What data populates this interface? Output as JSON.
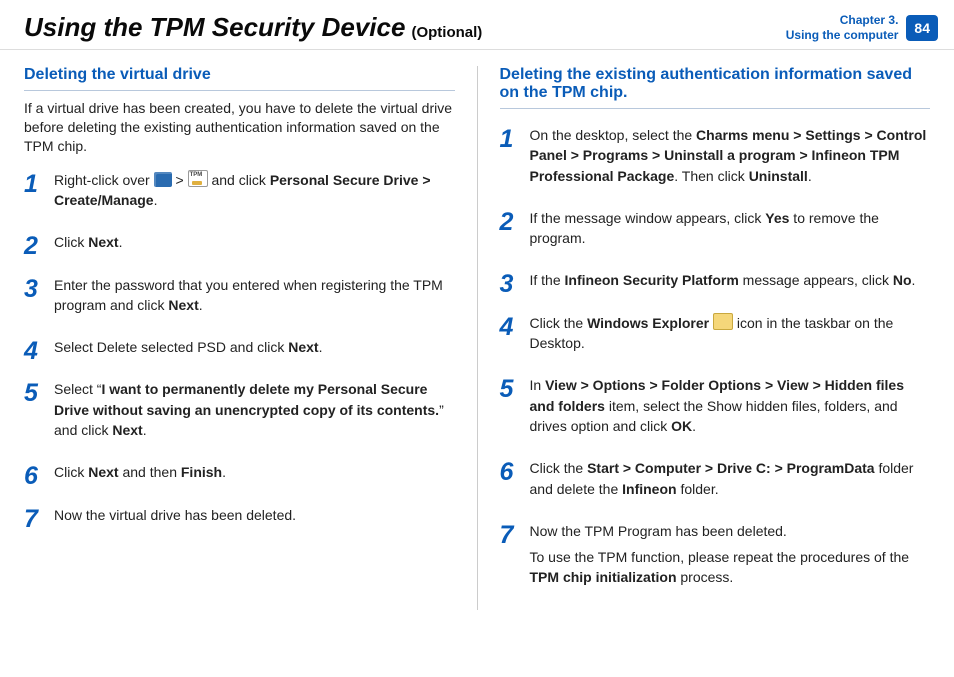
{
  "header": {
    "title": "Using the TPM Security Device",
    "subtitle": "(Optional)",
    "chapter_line1": "Chapter 3.",
    "chapter_line2": "Using the computer",
    "page_number": "84"
  },
  "left": {
    "heading": "Deleting the virtual drive",
    "intro": "If a virtual drive has been created, you have to delete the virtual drive before deleting the existing authentication information saved on the TPM chip.",
    "steps": {
      "s1_a": "Right-click over ",
      "s1_b": " > ",
      "s1_c": " and click ",
      "s1_d": "Personal Secure Drive > Create/Manage",
      "s1_e": ".",
      "s2_a": "Click ",
      "s2_b": "Next",
      "s2_c": ".",
      "s3_a": "Enter the password that you entered when registering the TPM program and click ",
      "s3_b": "Next",
      "s3_c": ".",
      "s4_a": "Select Delete selected PSD and click ",
      "s4_b": "Next",
      "s4_c": ".",
      "s5_a": "Select “",
      "s5_b": "I want to permanently delete my Personal Secure Drive without saving an unencrypted copy of its contents.",
      "s5_c": "” and click ",
      "s5_d": "Next",
      "s5_e": ".",
      "s6_a": "Click ",
      "s6_b": "Next",
      "s6_c": " and then ",
      "s6_d": "Finish",
      "s6_e": ".",
      "s7": "Now the virtual drive has been deleted."
    }
  },
  "right": {
    "heading": "Deleting the existing authentication information saved on the TPM chip.",
    "steps": {
      "s1_a": "On the desktop, select the ",
      "s1_b": "Charms menu > Settings > Control Panel  > Programs > Uninstall a program > Infineon TPM Professional Package",
      "s1_c": ". Then click ",
      "s1_d": "Uninstall",
      "s1_e": ".",
      "s2_a": "If the message window appears, click ",
      "s2_b": "Yes",
      "s2_c": " to remove the program.",
      "s3_a": "If the ",
      "s3_b": "Infineon Security Platform",
      "s3_c": " message appears, click ",
      "s3_d": "No",
      "s3_e": ".",
      "s4_a": "Click the ",
      "s4_b": "Windows Explorer",
      "s4_c": " icon in the taskbar on the Desktop.",
      "s5_a": "In ",
      "s5_b": "View > Options > Folder Options > View > Hidden files and folders",
      "s5_c": " item, select the Show hidden files, folders, and drives option and click ",
      "s5_d": "OK",
      "s5_e": ".",
      "s6_a": "Click the ",
      "s6_b": "Start > Computer > Drive C: > ProgramData",
      "s6_c": " folder and delete the ",
      "s6_d": "Infineon",
      "s6_e": " folder.",
      "s7_a": "Now the TPM Program has been deleted.",
      "s7_b": "To use the TPM function, please repeat the procedures of the ",
      "s7_c": "TPM chip initialization",
      "s7_d": " process."
    }
  }
}
